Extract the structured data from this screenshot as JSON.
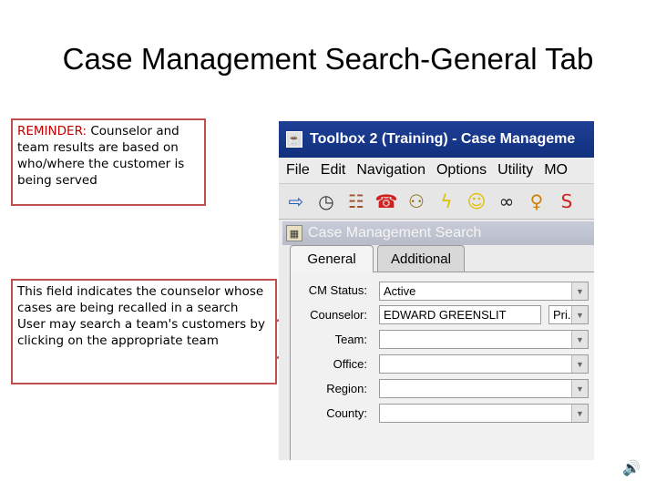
{
  "slide": {
    "title": "Case Management Search-General Tab"
  },
  "callouts": {
    "reminder": {
      "highlight": "REMINDER:",
      "text": " Counselor and team results are based on who/where the customer is being served"
    },
    "field_note": {
      "line1": "This field indicates the counselor whose cases are being recalled in a search",
      "line2": "User may search a team's customers by clicking on the appropriate team"
    }
  },
  "app": {
    "window_title": "Toolbox 2 (Training) - Case Manageme",
    "menu": [
      "File",
      "Edit",
      "Navigation",
      "Options",
      "Utility",
      "MO"
    ],
    "toolbar_icons": [
      "exit-icon",
      "clock-icon",
      "people-icon",
      "phone-icon",
      "person-search-icon",
      "lightning-icon",
      "smiley-icon",
      "binoculars-icon",
      "person-icon",
      "logo-icon"
    ],
    "subwindow_title": "Case Management Search",
    "tabs": [
      {
        "label": "General",
        "active": true
      },
      {
        "label": "Additional",
        "active": false
      }
    ],
    "form": {
      "cm_status_label": "CM Status:",
      "cm_status_value": "Active",
      "counselor_label": "Counselor:",
      "counselor_value": "EDWARD GREENSLIT",
      "counselor_type_value": "Pri...",
      "team_label": "Team:",
      "team_value": "",
      "office_label": "Office:",
      "office_value": "",
      "region_label": "Region:",
      "region_value": "",
      "county_label": "County:",
      "county_value": ""
    }
  },
  "colors": {
    "callout_border": "#c0504d",
    "highlight_text": "#c00000",
    "titlebar": "#1e3f95",
    "arrow": "#c0504d"
  }
}
